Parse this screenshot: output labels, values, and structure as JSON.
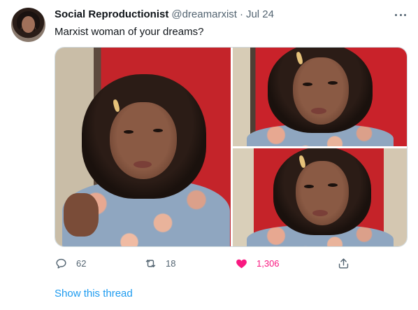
{
  "tweet": {
    "author_name": "Social Reproductionist",
    "author_handle": "@dreamarxist",
    "separator": "·",
    "date": "Jul 24",
    "text": "Marxist woman of your dreams?"
  },
  "actions": {
    "reply_count": "62",
    "retweet_count": "18",
    "like_count": "1,306"
  },
  "show_thread_label": "Show this thread",
  "colors": {
    "link": "#1d9bf0",
    "like": "#f91880",
    "muted": "#536471",
    "text": "#0f1419"
  },
  "icons": [
    "more-icon",
    "reply-icon",
    "retweet-icon",
    "heart-icon",
    "share-icon"
  ]
}
